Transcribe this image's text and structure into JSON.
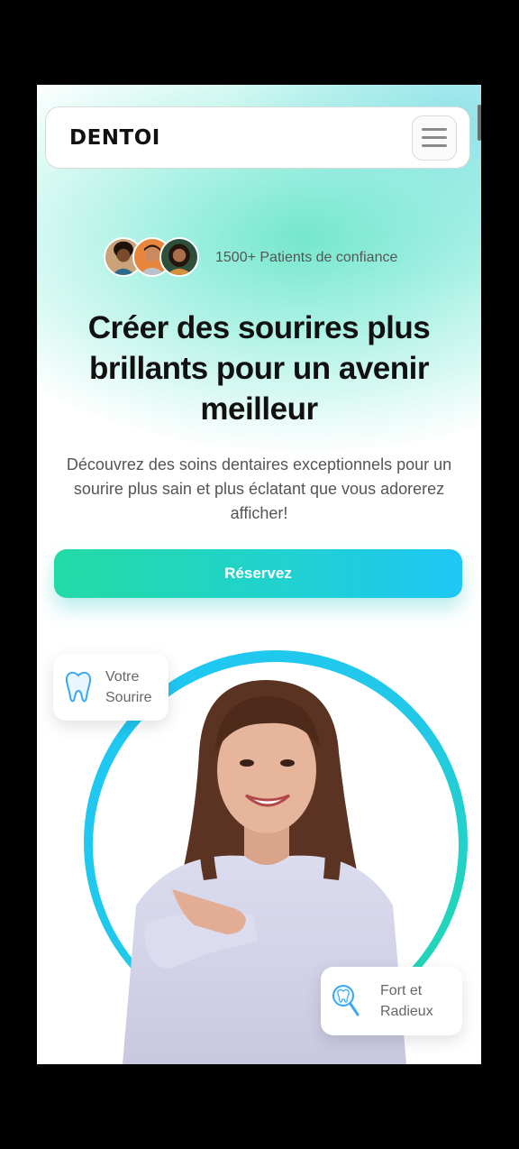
{
  "header": {
    "logo": "DENTOI",
    "menu_icon": "hamburger-menu-icon"
  },
  "trust": {
    "text": "1500+ Patients de confiance"
  },
  "hero": {
    "headline": "Créer des sourires plus brillants pour un avenir meilleur",
    "subtext": "Découvrez des soins dentaires exceptionnels pour un sourire plus sain et plus éclatant que vous adorerez afficher!",
    "cta_label": "Réservez"
  },
  "badges": {
    "smile": {
      "line1": "Votre",
      "line2": "Sourire",
      "icon": "tooth-icon"
    },
    "strong": {
      "line1": "Fort et",
      "line2": "Radieux",
      "icon": "tooth-search-icon"
    }
  },
  "colors": {
    "accent_green": "#22dba4",
    "accent_blue": "#1ec7f5",
    "text_dark": "#111111",
    "text_muted": "#555555"
  }
}
